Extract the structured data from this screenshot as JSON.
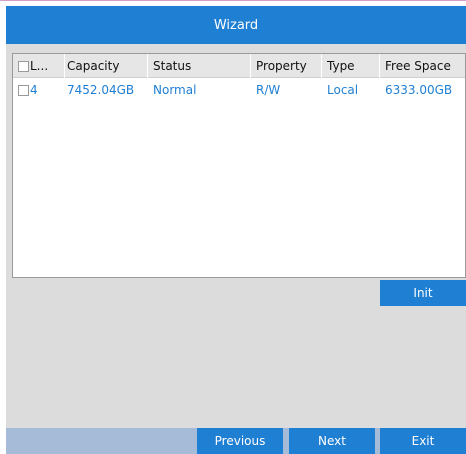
{
  "window": {
    "title": "Wizard"
  },
  "table": {
    "headers": [
      "L...",
      "Capacity",
      "Status",
      "Property",
      "Type",
      "Free Space"
    ],
    "rows": [
      [
        "4",
        "7452.04GB",
        "Normal",
        "R/W",
        "Local",
        "6333.00GB"
      ]
    ]
  },
  "actions": {
    "init_label": "Init"
  },
  "footer": {
    "previous_label": "Previous",
    "next_label": "Next",
    "exit_label": "Exit"
  },
  "colors": {
    "accent": "#1f7fd3",
    "panel": "#dcdcdc",
    "footer": "#a6bbd8"
  }
}
